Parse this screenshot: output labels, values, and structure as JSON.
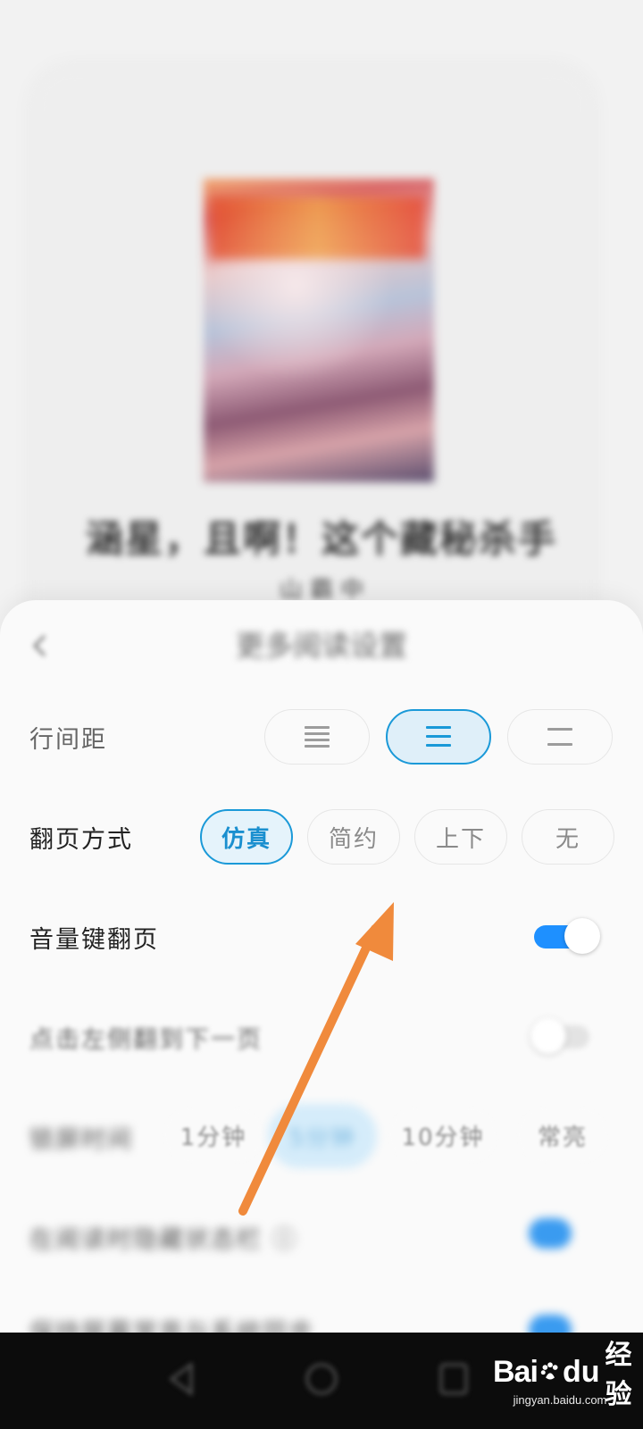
{
  "book": {
    "title": "涵星，且啊！这个藏秘杀手",
    "author": "山 霸 中"
  },
  "sheet": {
    "title": "更多阅读设置",
    "back_icon": "back-arrow-icon"
  },
  "line_spacing": {
    "label": "行间距",
    "options": [
      {
        "icon": "lines-dense-icon",
        "selected": false
      },
      {
        "icon": "lines-medium-icon",
        "selected": true
      },
      {
        "icon": "lines-loose-icon",
        "selected": false
      }
    ]
  },
  "page_turn": {
    "label": "翻页方式",
    "options": [
      {
        "label": "仿真",
        "selected": true
      },
      {
        "label": "简约",
        "selected": false
      },
      {
        "label": "上下",
        "selected": false
      },
      {
        "label": "无",
        "selected": false
      }
    ]
  },
  "volume_key": {
    "label": "音量键翻页",
    "enabled": true
  },
  "tap_left": {
    "label": "点击左侧翻到下一页",
    "enabled": false
  },
  "auto_lock": {
    "label": "锁屏时间",
    "options": [
      {
        "label": "1分钟",
        "selected": false
      },
      {
        "label": "5分钟",
        "selected": true
      },
      {
        "label": "10分钟",
        "selected": false
      },
      {
        "label": "常亮",
        "selected": false
      }
    ]
  },
  "extra_rows": [
    {
      "label": "在阅读时隐藏状态栏 ⓘ",
      "enabled": true
    },
    {
      "label": "保持屏幕常亮与系统同步",
      "enabled": true
    }
  ],
  "nav": {
    "back_icon": "nav-back-icon",
    "home_icon": "nav-home-icon",
    "recents_icon": "nav-recents-icon"
  },
  "watermark": {
    "brand_left": "Bai",
    "brand_mid": "du",
    "brand_suffix": "经验",
    "url": "jingyan.baidu.com"
  },
  "colors": {
    "accent": "#1a99d8",
    "toggle_on": "#1e90ff",
    "arrow": "#f08a3c"
  }
}
